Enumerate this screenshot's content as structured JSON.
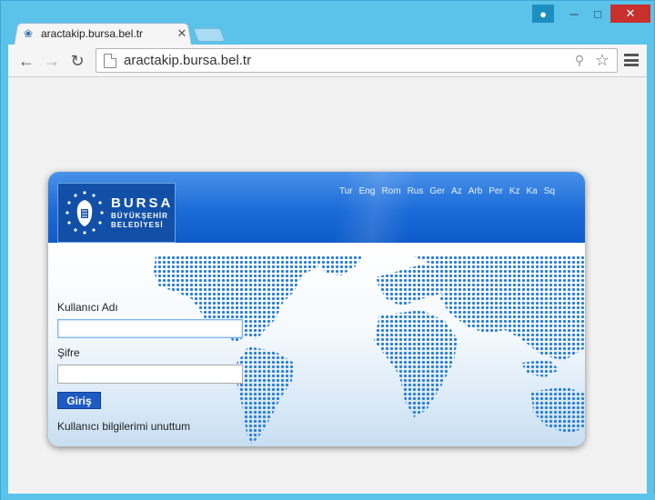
{
  "browser": {
    "tab_title": "aractakip.bursa.bel.tr",
    "url": "aractakip.bursa.bel.tr",
    "icons": {
      "back": "back-arrow-icon",
      "forward": "forward-arrow-icon",
      "reload": "reload-icon",
      "key": "key-icon",
      "star": "star-icon",
      "menu": "hamburger-menu-icon"
    }
  },
  "header": {
    "logo": {
      "main": "BURSA",
      "line1": "BÜYÜKŞEHİR",
      "line2": "BELEDİYESİ"
    },
    "languages": [
      "Tur",
      "Eng",
      "Rom",
      "Rus",
      "Ger",
      "Az",
      "Arb",
      "Per",
      "Kz",
      "Ka",
      "Sq"
    ]
  },
  "login": {
    "username_label": "Kullanıcı Adı",
    "username_value": "",
    "password_label": "Şifre",
    "password_value": "",
    "submit_label": "Giriş",
    "forgot_label": "Kullanıcı bilgilerimi unuttum"
  },
  "colors": {
    "header_blue": "#1a6ad8",
    "button_blue": "#1d5bc2",
    "map_dots": "#2a7fd8"
  }
}
